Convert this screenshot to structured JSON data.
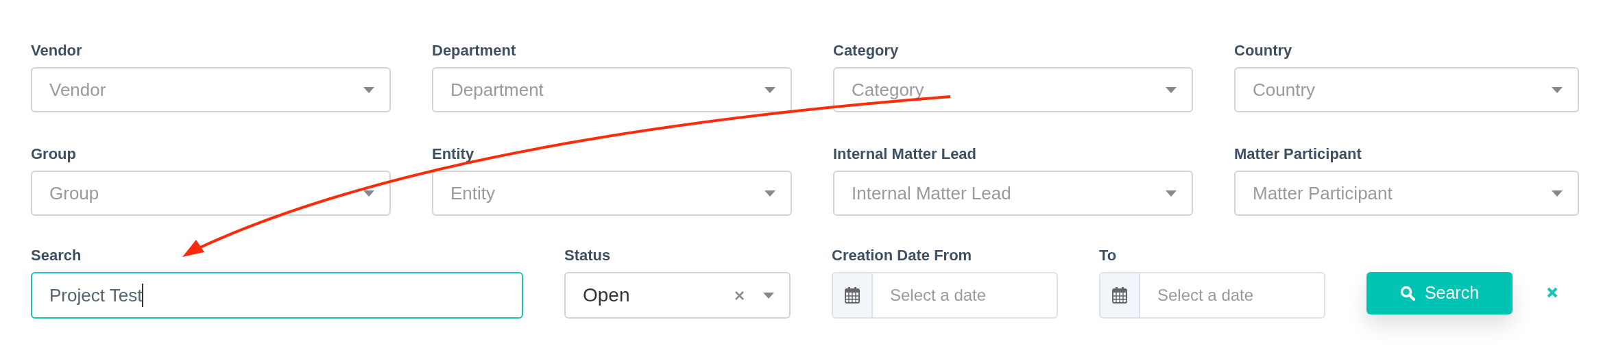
{
  "filters": [
    {
      "label": "Vendor",
      "placeholder": "Vendor"
    },
    {
      "label": "Department",
      "placeholder": "Department"
    },
    {
      "label": "Category",
      "placeholder": "Category"
    },
    {
      "label": "Country",
      "placeholder": "Country"
    },
    {
      "label": "Group",
      "placeholder": "Group"
    },
    {
      "label": "Entity",
      "placeholder": "Entity"
    },
    {
      "label": "Internal Matter Lead",
      "placeholder": "Internal Matter Lead"
    },
    {
      "label": "Matter Participant",
      "placeholder": "Matter Participant"
    }
  ],
  "search": {
    "label": "Search",
    "value": "Project Test",
    "focused": true
  },
  "status": {
    "label": "Status",
    "value": "Open"
  },
  "date_from": {
    "label": "Creation Date From",
    "placeholder": "Select a date"
  },
  "date_to": {
    "label": "To",
    "placeholder": "Select a date"
  },
  "search_button": {
    "label": "Search"
  }
}
